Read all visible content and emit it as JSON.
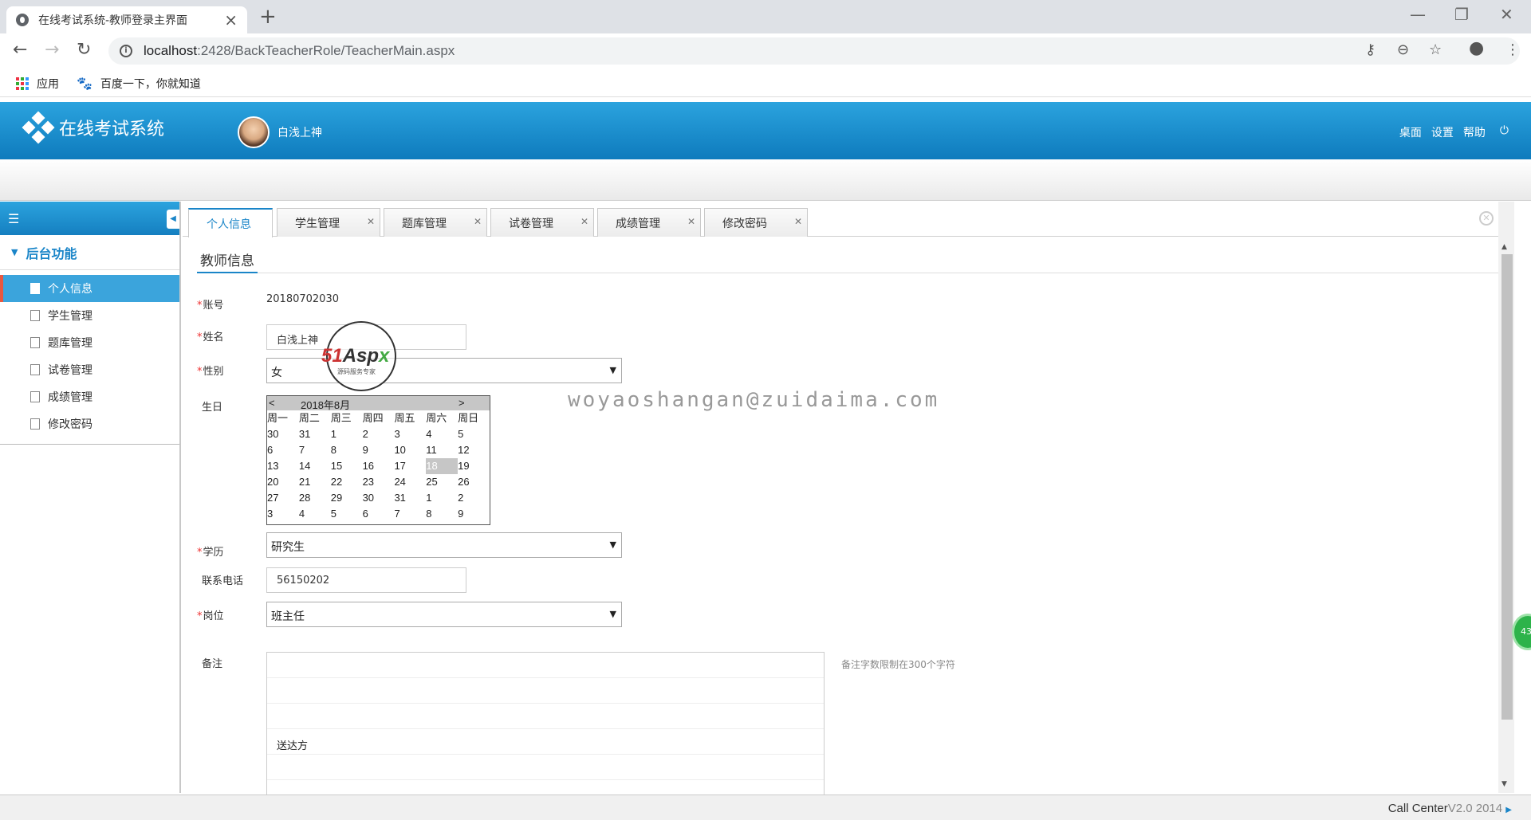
{
  "browser": {
    "tab_title": "在线考试系统-教师登录主界面",
    "url_host": "localhost",
    "url_rest": ":2428/BackTeacherRole/TeacherMain.aspx",
    "bookmarks": [
      "应用",
      "百度一下，你就知道"
    ]
  },
  "header": {
    "system_name": "在线考试系统",
    "user_name": "白浅上神",
    "links": [
      "桌面",
      "设置",
      "帮助"
    ]
  },
  "sidebar": {
    "group": "后台功能",
    "items": [
      "个人信息",
      "学生管理",
      "题库管理",
      "试卷管理",
      "成绩管理",
      "修改密码"
    ],
    "active_index": 0
  },
  "tabs": [
    "个人信息",
    "学生管理",
    "题库管理",
    "试卷管理",
    "成绩管理",
    "修改密码"
  ],
  "form": {
    "section_title": "教师信息",
    "account_label": "账号",
    "account_value": "20180702030",
    "name_label": "姓名",
    "name_value": "白浅上神",
    "gender_label": "性别",
    "gender_value": "女",
    "birthday_label": "生日",
    "education_label": "学历",
    "education_value": "研究生",
    "phone_label": "联系电话",
    "phone_value": "56150202",
    "post_label": "岗位",
    "post_value": "班主任",
    "notes_label": "备注",
    "notes_value": "送达方",
    "notes_hint": "备注字数限制在300个字符"
  },
  "calendar": {
    "prev": "<",
    "next": ">",
    "month_title": "2018年8月",
    "weekdays": [
      "周一",
      "周二",
      "周三",
      "周四",
      "周五",
      "周六",
      "周日"
    ],
    "weeks": [
      [
        "30",
        "31",
        "1",
        "2",
        "3",
        "4",
        "5"
      ],
      [
        "6",
        "7",
        "8",
        "9",
        "10",
        "11",
        "12"
      ],
      [
        "13",
        "14",
        "15",
        "16",
        "17",
        "18",
        "19"
      ],
      [
        "20",
        "21",
        "22",
        "23",
        "24",
        "25",
        "26"
      ],
      [
        "27",
        "28",
        "29",
        "30",
        "31",
        "1",
        "2"
      ],
      [
        "3",
        "4",
        "5",
        "6",
        "7",
        "8",
        "9"
      ]
    ],
    "selected_day": "18"
  },
  "watermark": {
    "text": "woyaoshangan@zuidaima.com",
    "logo_51": "51",
    "logo_aspx": "Asp",
    "logo_x": "x",
    "logo_sub": "源码服务专家"
  },
  "bubble": "43",
  "footer": {
    "brand": "Call Center",
    "version": "V2.0 2014"
  }
}
